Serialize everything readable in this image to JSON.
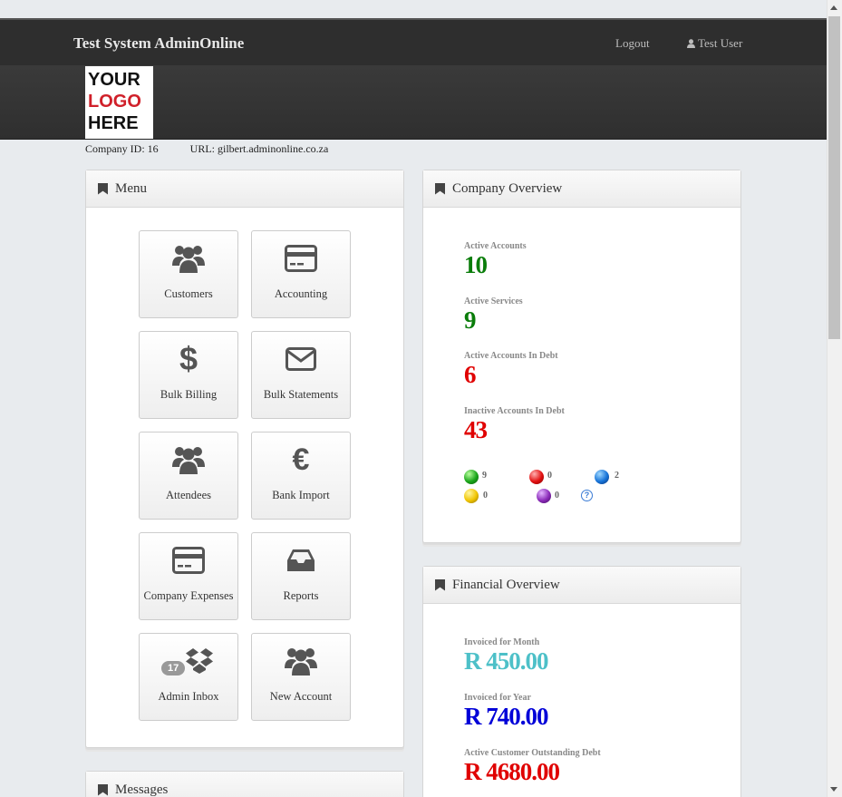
{
  "navbar": {
    "brand": "Test System AdminOnline",
    "logout": "Logout",
    "user": "Test User"
  },
  "logo": {
    "line1": "YOUR",
    "line2": "LOGO",
    "line3": "HERE"
  },
  "company": {
    "id_text": "Company ID: 16",
    "url_text": "URL: gilbert.adminonline.co.za"
  },
  "menu": {
    "title": "Menu",
    "tiles": [
      {
        "label": "Customers",
        "icon": "users-icon"
      },
      {
        "label": "Accounting",
        "icon": "credit-card-icon"
      },
      {
        "label": "Bulk Billing",
        "icon": "dollar-icon"
      },
      {
        "label": "Bulk Statements",
        "icon": "envelope-icon"
      },
      {
        "label": "Attendees",
        "icon": "users-icon"
      },
      {
        "label": "Bank Import",
        "icon": "euro-icon"
      },
      {
        "label": "Company Expenses",
        "icon": "credit-card-icon"
      },
      {
        "label": "Reports",
        "icon": "inbox-icon"
      },
      {
        "label": "Admin Inbox",
        "icon": "dropbox-icon",
        "badge": "17"
      },
      {
        "label": "New Account",
        "icon": "users-icon"
      }
    ]
  },
  "overview": {
    "title": "Company Overview",
    "stats": [
      {
        "label": "Active Accounts",
        "value": "10",
        "color": "#0a7d0a"
      },
      {
        "label": "Active Services",
        "value": "9",
        "color": "#0a7d0a"
      },
      {
        "label": "Active Accounts In Debt",
        "value": "6",
        "color": "#e00000"
      },
      {
        "label": "Inactive Accounts In Debt",
        "value": "43",
        "color": "#e00000"
      }
    ],
    "dots": [
      {
        "color": "green",
        "count": "9"
      },
      {
        "color": "red",
        "count": "0"
      },
      {
        "color": "blue",
        "count": "2"
      },
      {
        "color": "yellow",
        "count": "0"
      },
      {
        "color": "purple",
        "count": "0"
      },
      {
        "color": "help",
        "count": ""
      }
    ]
  },
  "financial": {
    "title": "Financial Overview",
    "stats": [
      {
        "label": "Invoiced for Month",
        "value": "R 450.00",
        "color": "#4dc0c8"
      },
      {
        "label": "Invoiced for Year",
        "value": "R 740.00",
        "color": "#0000d8"
      },
      {
        "label": "Active Customer Outstanding Debt",
        "value": "R 4680.00",
        "color": "#e00000"
      }
    ]
  },
  "messages": {
    "title": "Messages"
  }
}
